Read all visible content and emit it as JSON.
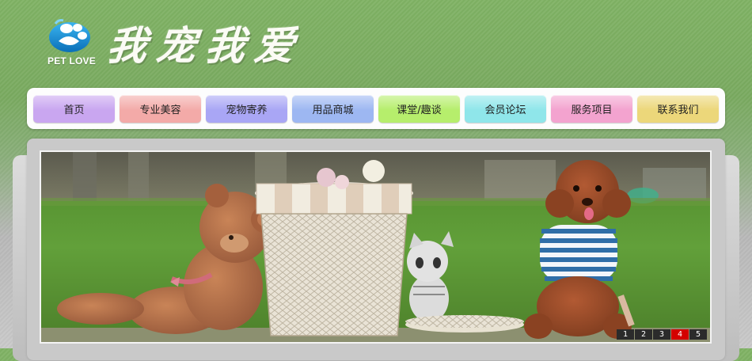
{
  "header": {
    "logo_text": "PET LOVE",
    "site_title": "我宠我爱",
    "logo_icon": "paw-bubble-icon"
  },
  "nav": {
    "items": [
      {
        "label": "首页",
        "color": "#c9a6f0"
      },
      {
        "label": "专业美容",
        "color": "#f3aaa8"
      },
      {
        "label": "宠物寄养",
        "color": "#a9a6f5"
      },
      {
        "label": "用品商城",
        "color": "#9db7f2"
      },
      {
        "label": "课堂/趣谈",
        "color": "#b6ee6c"
      },
      {
        "label": "会员论坛",
        "color": "#8fe6ea"
      },
      {
        "label": "服务项目",
        "color": "#f3a3cf"
      },
      {
        "label": "联系我们",
        "color": "#ecd77a"
      }
    ]
  },
  "banner": {
    "image_icon": "pets-banner-photo",
    "pages": [
      "1",
      "2",
      "3",
      "4",
      "5"
    ],
    "active_page": "4"
  }
}
